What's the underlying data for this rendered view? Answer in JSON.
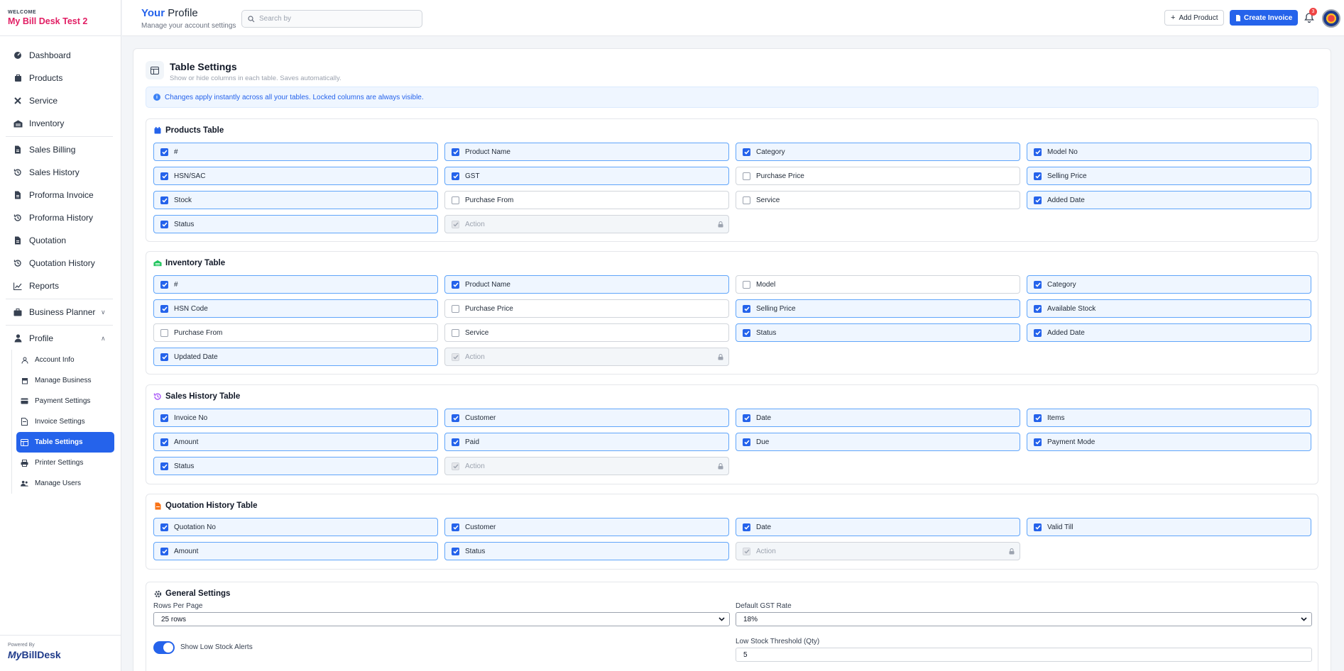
{
  "sidebar": {
    "welcome": "WELCOME",
    "business_name": "My Bill Desk Test 2",
    "items": [
      {
        "label": "Dashboard",
        "icon": "dashboard-icon"
      },
      {
        "label": "Products",
        "icon": "box-icon"
      },
      {
        "label": "Service",
        "icon": "tools-icon"
      },
      {
        "label": "Inventory",
        "icon": "warehouse-icon"
      },
      {
        "label": "Sales Billing",
        "icon": "document-icon"
      },
      {
        "label": "Sales History",
        "icon": "history-icon"
      },
      {
        "label": "Proforma Invoice",
        "icon": "document-icon"
      },
      {
        "label": "Proforma History",
        "icon": "history-icon"
      },
      {
        "label": "Quotation",
        "icon": "document-icon"
      },
      {
        "label": "Quotation History",
        "icon": "history-icon"
      },
      {
        "label": "Reports",
        "icon": "chart-icon"
      },
      {
        "label": "Business Planner",
        "icon": "briefcase-icon"
      },
      {
        "label": "Profile",
        "icon": "user-icon"
      }
    ],
    "profile_sub": [
      {
        "label": "Account Info"
      },
      {
        "label": "Manage Business"
      },
      {
        "label": "Payment Settings"
      },
      {
        "label": "Invoice Settings"
      },
      {
        "label": "Table Settings"
      },
      {
        "label": "Printer Settings"
      },
      {
        "label": "Manage Users"
      }
    ],
    "powered_by": "Powered By",
    "logo_my": "My",
    "logo_bill": "BillDesk"
  },
  "topbar": {
    "title_your": "Your",
    "title_rest": " Profile",
    "subtitle": "Manage your account settings",
    "search_placeholder": "Search by",
    "add_product": "Add Product",
    "create_invoice": "Create Invoice",
    "notif_count": "3"
  },
  "page": {
    "title": "Table Settings",
    "subtitle": "Show or hide columns in each table. Saves automatically.",
    "info": "Changes apply instantly across all your tables. Locked columns are always visible."
  },
  "tables": [
    {
      "title": "Products Table",
      "columns": [
        {
          "label": "#",
          "checked": true
        },
        {
          "label": "Product Name",
          "checked": true
        },
        {
          "label": "Category",
          "checked": true
        },
        {
          "label": "Model No",
          "checked": true
        },
        {
          "label": "HSN/SAC",
          "checked": true
        },
        {
          "label": "GST",
          "checked": true
        },
        {
          "label": "Purchase Price",
          "checked": false
        },
        {
          "label": "Selling Price",
          "checked": true
        },
        {
          "label": "Stock",
          "checked": true
        },
        {
          "label": "Purchase From",
          "checked": false
        },
        {
          "label": "Service",
          "checked": false
        },
        {
          "label": "Added Date",
          "checked": true
        },
        {
          "label": "Status",
          "checked": true
        },
        {
          "label": "Action",
          "checked": true,
          "locked": true
        }
      ]
    },
    {
      "title": "Inventory Table",
      "columns": [
        {
          "label": "#",
          "checked": true
        },
        {
          "label": "Product Name",
          "checked": true
        },
        {
          "label": "Model",
          "checked": false
        },
        {
          "label": "Category",
          "checked": true
        },
        {
          "label": "HSN Code",
          "checked": true
        },
        {
          "label": "Purchase Price",
          "checked": false
        },
        {
          "label": "Selling Price",
          "checked": true
        },
        {
          "label": "Available Stock",
          "checked": true
        },
        {
          "label": "Purchase From",
          "checked": false
        },
        {
          "label": "Service",
          "checked": false
        },
        {
          "label": "Status",
          "checked": true
        },
        {
          "label": "Added Date",
          "checked": true
        },
        {
          "label": "Updated Date",
          "checked": true
        },
        {
          "label": "Action",
          "checked": true,
          "locked": true
        }
      ]
    },
    {
      "title": "Sales History Table",
      "columns": [
        {
          "label": "Invoice No",
          "checked": true
        },
        {
          "label": "Customer",
          "checked": true
        },
        {
          "label": "Date",
          "checked": true
        },
        {
          "label": "Items",
          "checked": true
        },
        {
          "label": "Amount",
          "checked": true
        },
        {
          "label": "Paid",
          "checked": true
        },
        {
          "label": "Due",
          "checked": true
        },
        {
          "label": "Payment Mode",
          "checked": true
        },
        {
          "label": "Status",
          "checked": true
        },
        {
          "label": "Action",
          "checked": true,
          "locked": true
        }
      ]
    },
    {
      "title": "Quotation History Table",
      "columns": [
        {
          "label": "Quotation No",
          "checked": true
        },
        {
          "label": "Customer",
          "checked": true
        },
        {
          "label": "Date",
          "checked": true
        },
        {
          "label": "Valid Till",
          "checked": true
        },
        {
          "label": "Amount",
          "checked": true
        },
        {
          "label": "Status",
          "checked": true
        },
        {
          "label": "Action",
          "checked": true,
          "locked": true
        }
      ]
    }
  ],
  "general": {
    "title": "General Settings",
    "rows_per_page_label": "Rows Per Page",
    "rows_per_page_value": "25 rows",
    "gst_label": "Default GST Rate",
    "gst_value": "18%",
    "low_stock_toggle_label": "Show Low Stock Alerts",
    "low_stock_toggle_on": true,
    "threshold_label": "Low Stock Threshold (Qty)",
    "threshold_value": "5"
  },
  "colors": {
    "accent": "#2563eb",
    "brand_pink": "#e11d63"
  }
}
